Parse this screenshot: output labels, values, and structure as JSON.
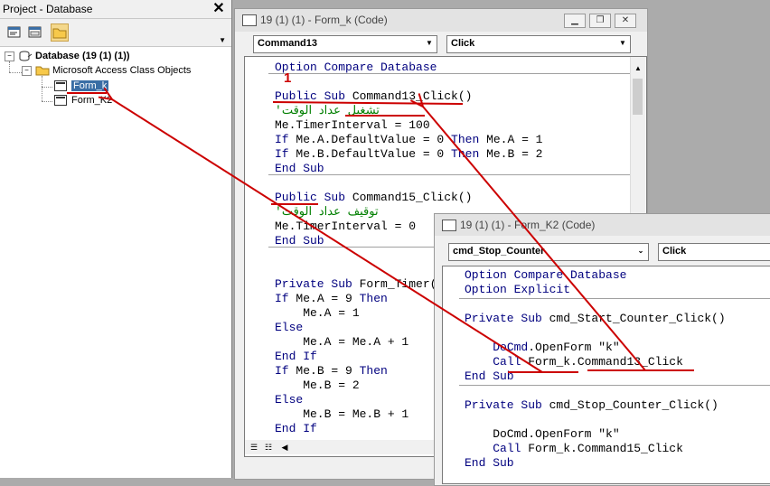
{
  "project": {
    "title": "Project - Database",
    "close_glyph": "✕",
    "tree": {
      "root": "Database (19 (1) (1))",
      "folder": "Microsoft Access Class Objects",
      "items": [
        "Form_k",
        "Form_K2"
      ]
    },
    "expand_glyph": "−"
  },
  "annotation_number": "1",
  "win1": {
    "title": "19 (1) (1) - Form_k (Code)",
    "object_combo": "Command13",
    "proc_combo": "Click"
  },
  "win2": {
    "title": "19 (1) (1) - Form_K2 (Code)",
    "object_combo": "cmd_Stop_Counter",
    "proc_combo": "Click"
  },
  "colors": {
    "keyword": "#00007f",
    "comment": "#007f00",
    "annotation": "#cc0000",
    "selection": "#3a6ea5"
  },
  "icons": [
    "database-icon",
    "folder-icon",
    "form-icon",
    "view-code-icon",
    "view-object-icon",
    "toggle-folders-icon"
  ]
}
